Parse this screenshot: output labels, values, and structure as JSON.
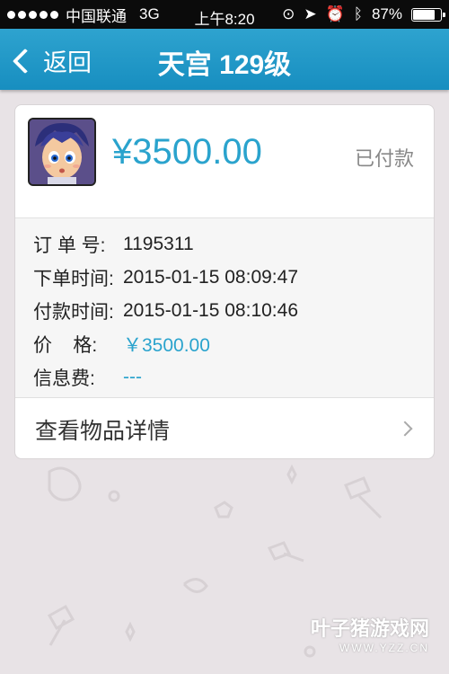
{
  "status_bar": {
    "carrier": "中国联通",
    "network": "3G",
    "time": "上午8:20",
    "battery": "87%",
    "battery_level": 0.87
  },
  "nav": {
    "back_label": "返回",
    "title": "天宫 129级"
  },
  "order": {
    "amount": "¥3500.00",
    "status": "已付款",
    "rows": [
      {
        "label": "订 单 号:",
        "value": "1195311"
      },
      {
        "label": "下单时间:",
        "value": "2015-01-15 08:09:47"
      },
      {
        "label": "付款时间:",
        "value": "2015-01-15 08:10:46"
      },
      {
        "label": "价    格:",
        "value": "￥3500.00"
      },
      {
        "label": "信息费:",
        "value": "---"
      }
    ],
    "view_details_label": "查看物品详情"
  },
  "watermark": {
    "main": "叶子猪游戏网",
    "sub": "WWW.YZZ.CN"
  },
  "colors": {
    "accent": "#2aa3cd",
    "nav_bg": "#1d94c4"
  }
}
